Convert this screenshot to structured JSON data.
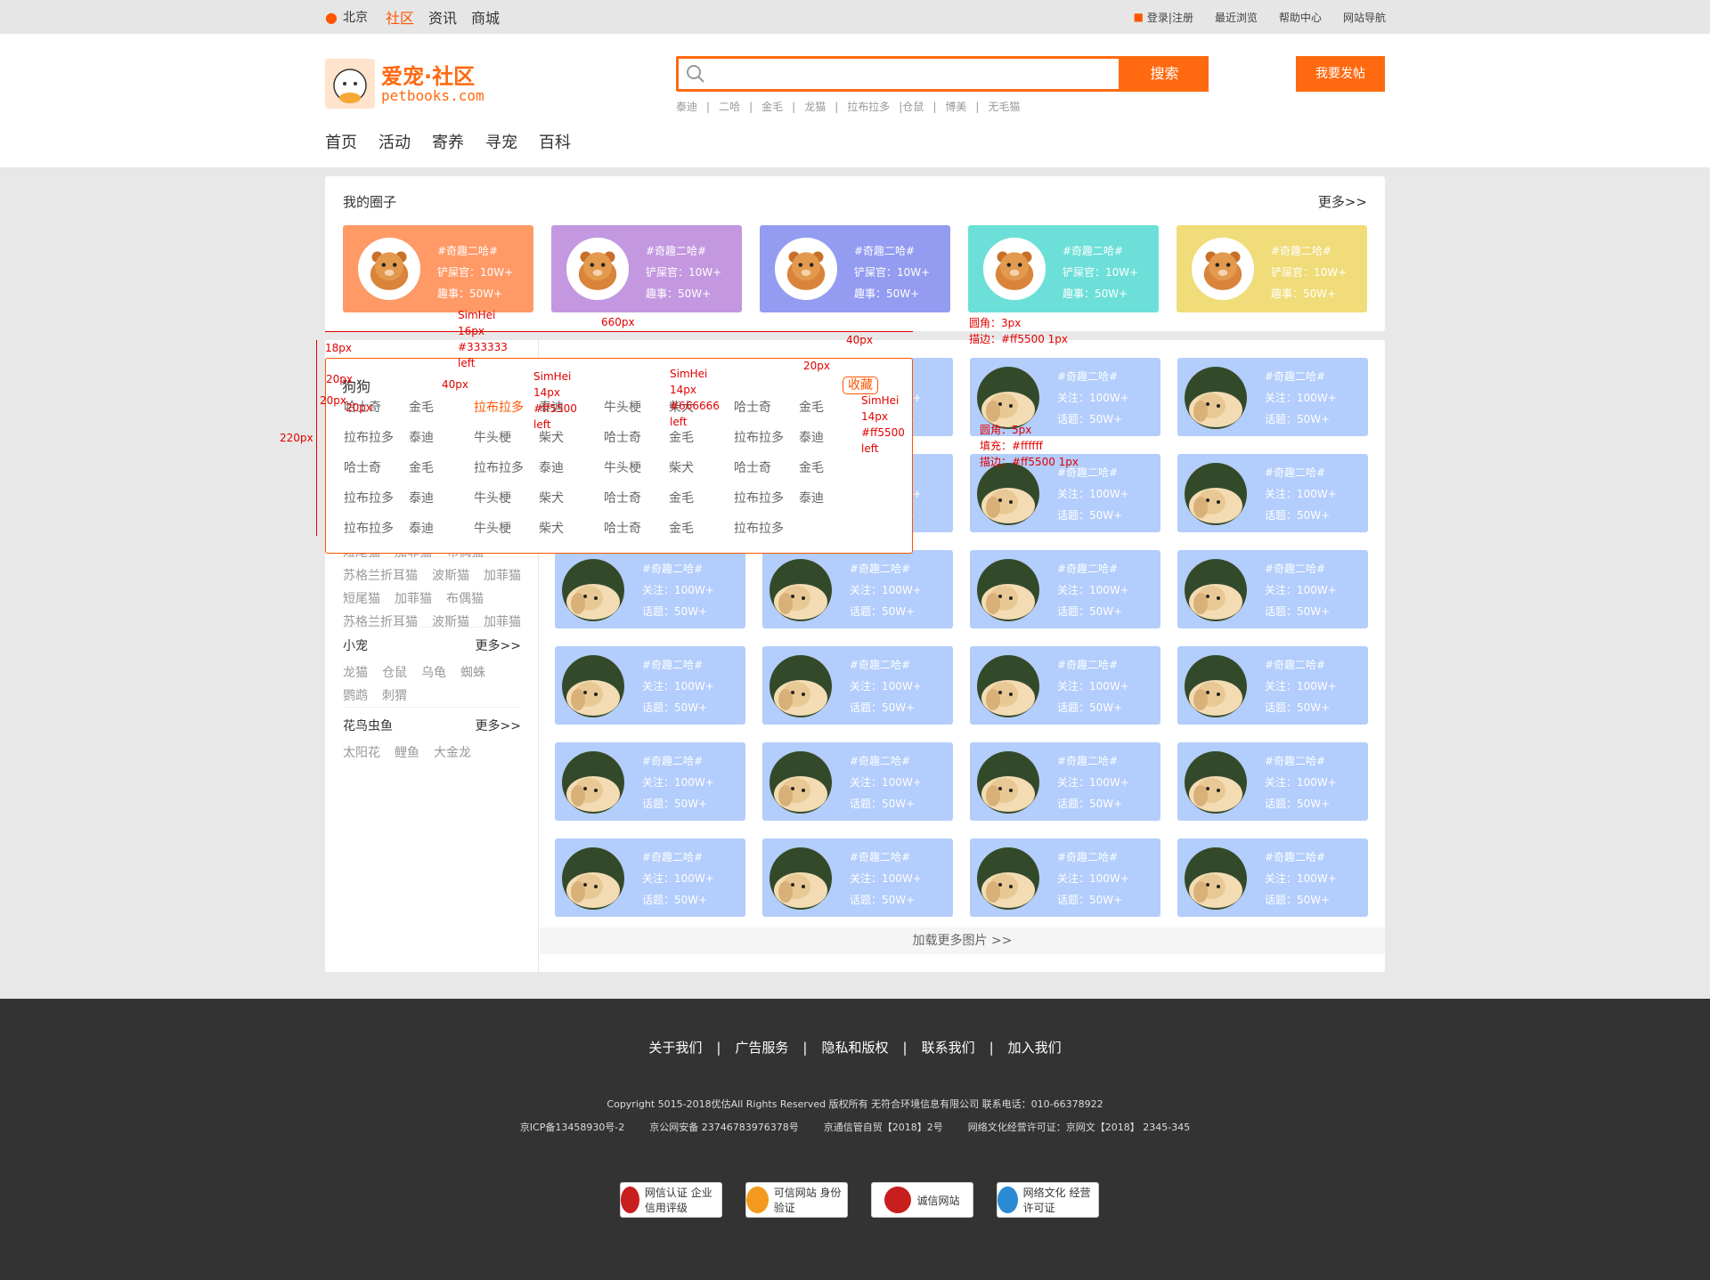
{
  "topbar": {
    "city": "北京",
    "nav": [
      "社区",
      "资讯",
      "商城"
    ],
    "login": "登录|注册",
    "links": [
      "最近浏览",
      "帮助中心",
      "网站导航"
    ]
  },
  "header": {
    "logo_title": "爱宠·社区",
    "logo_domain": "petbooks.com",
    "search_button": "搜索",
    "hot_tags": [
      "泰迪",
      "|",
      "二哈",
      "|",
      "金毛",
      "|",
      "龙猫",
      "|",
      "拉布拉多",
      "|仓鼠",
      "|",
      "博美",
      "|",
      "无毛猫"
    ],
    "post_button": "我要发帖",
    "nav": [
      "首页",
      "活动",
      "寄养",
      "寻宠",
      "百科"
    ]
  },
  "circles": {
    "title": "我的圈子",
    "more": "更多>>",
    "card_colors": [
      "#ff9966",
      "#c398e0",
      "#939cf0",
      "#6ce0d8",
      "#f0dc78"
    ],
    "card": {
      "tag": "#奇趣二哈#",
      "line1": "铲屎官：10W+",
      "line2": "趣事：50W+"
    }
  },
  "popup": {
    "title": "狗狗",
    "fav": "收藏",
    "tags": [
      "哈士奇",
      "金毛",
      "拉布拉多",
      "泰迪",
      "牛头梗",
      "柴犬",
      "哈士奇",
      "金毛",
      "拉布拉多",
      "泰迪",
      "牛头梗",
      "柴犬",
      "哈士奇",
      "金毛",
      "拉布拉多",
      "泰迪",
      "哈士奇",
      "金毛",
      "拉布拉多",
      "泰迪",
      "牛头梗",
      "柴犬",
      "哈士奇",
      "金毛",
      "拉布拉多",
      "泰迪",
      "牛头梗",
      "柴犬",
      "哈士奇",
      "金毛",
      "拉布拉多",
      "泰迪",
      "拉布拉多",
      "泰迪",
      "牛头梗",
      "柴犬",
      "哈士奇",
      "金毛",
      "拉布拉多"
    ]
  },
  "sidebar": {
    "cat_items": [
      "短尾猫",
      "加菲猫",
      "布偶猫",
      "苏格兰折耳猫",
      "波斯猫",
      "加菲猫",
      "短尾猫",
      "加菲猫",
      "布偶猫",
      "苏格兰折耳猫",
      "波斯猫",
      "加菲猫"
    ],
    "small_title": "小宠",
    "small_more": "更多>>",
    "small_items": [
      "龙猫",
      "仓鼠",
      "乌龟",
      "蜘蛛",
      "鹦鹉",
      "刺猬"
    ],
    "flower_title": "花鸟虫鱼",
    "flower_more": "更多>>",
    "flower_items": [
      "太阳花",
      "鲤鱼",
      "大金龙"
    ]
  },
  "grid": {
    "card": {
      "tag": "#奇趣二哈#",
      "line1": "关注：100W+",
      "line2": "话题：50W+"
    }
  },
  "loadmore": "加载更多图片 >>",
  "annotations": {
    "a1": "SimHei",
    "a2": "16px",
    "a3": "#333333",
    "a4": "left",
    "w660": "660px",
    "r3": "圆角：3px",
    "b1": "描边：#ff5500 1px",
    "px18": "18px",
    "px20a": "20px",
    "px40": "40px",
    "px20b": "20px",
    "px20c": "20px",
    "h220": "220px",
    "px40b": "40px",
    "px20d": "20px",
    "s1": "SimHei",
    "s2": "14px",
    "s3": "#ff5500",
    "s4": "left",
    "t1": "SimHei",
    "t2": "14px",
    "t3": "#666666",
    "t4": "left",
    "u1": "SimHei",
    "u2": "14px",
    "u3": "#ff5500",
    "u4": "left",
    "r5": "圆角：5px",
    "fill": "填充：#ffffff",
    "b2": "描边：#ff5500 1px"
  },
  "footer": {
    "links": [
      "关于我们",
      "|",
      "广告服务",
      "|",
      "隐私和版权",
      "|",
      "联系我们",
      "|",
      "加入我们"
    ],
    "copyright": "Copyright 5015-2018优估All Rights Reserved 版权所有 无符合环境信息有限公司 联系电话：010-66378922",
    "icp": [
      "京ICP备13458930号-2",
      "京公网安备 237467839763​78号",
      "京通信管自贸【2018】2号",
      "网络文化经营许可证：京网文【2018】 2345-345"
    ],
    "badges": [
      "网信认证 企业信用评级",
      "可信网站 身份验证",
      "诚信网站",
      "网络文化 经营许可证"
    ]
  }
}
